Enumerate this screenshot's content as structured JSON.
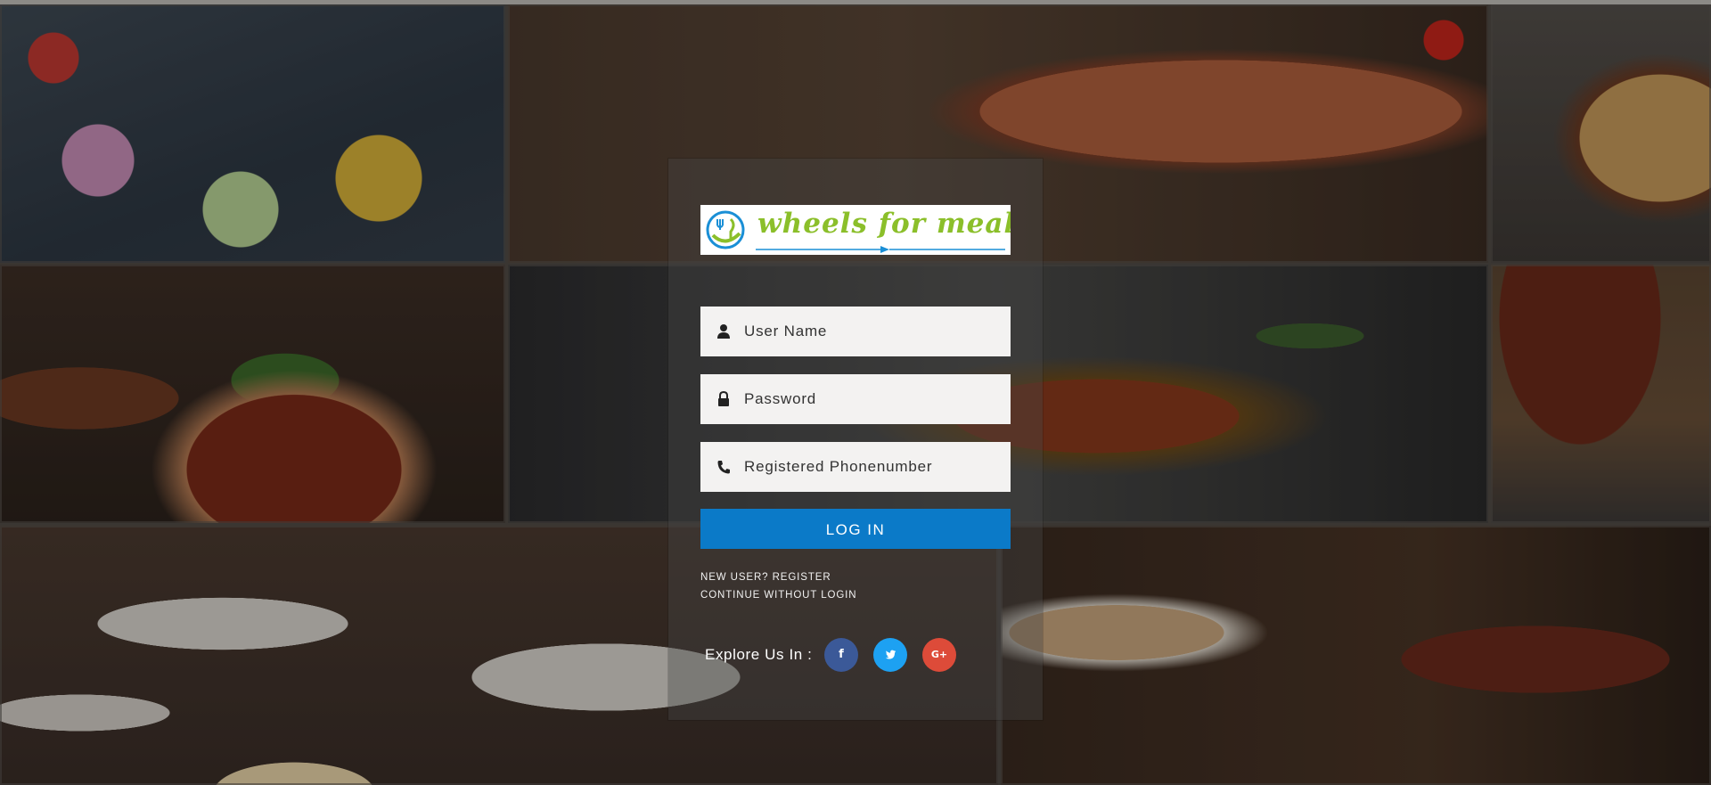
{
  "logo": {
    "text": "wheels for meals",
    "colors": {
      "green": "#8bbf2a",
      "blue": "#1a8fd6"
    },
    "icon": "fork-knife-wheel-icon"
  },
  "form": {
    "username": {
      "placeholder": "User Name",
      "value": "",
      "icon": "user-icon"
    },
    "password": {
      "placeholder": "Password",
      "value": "",
      "icon": "lock-icon"
    },
    "phone": {
      "placeholder": "Registered Phonenumber",
      "value": "",
      "icon": "phone-icon"
    },
    "login_label": "LOG IN",
    "login_color": "#0b7ac8"
  },
  "links": {
    "register": "NEW USER? REGISTER",
    "continue": "CONTINUE WITHOUT LOGIN"
  },
  "social": {
    "label": "Explore Us In :",
    "items": [
      {
        "name": "facebook",
        "glyph": "f",
        "icon": "facebook-icon",
        "color": "#3b5998"
      },
      {
        "name": "twitter",
        "glyph": "🐦",
        "icon": "twitter-icon",
        "color": "#1da1f2"
      },
      {
        "name": "google-plus",
        "glyph": "G+",
        "icon": "google-plus-icon",
        "color": "#dd4b39"
      }
    ]
  }
}
